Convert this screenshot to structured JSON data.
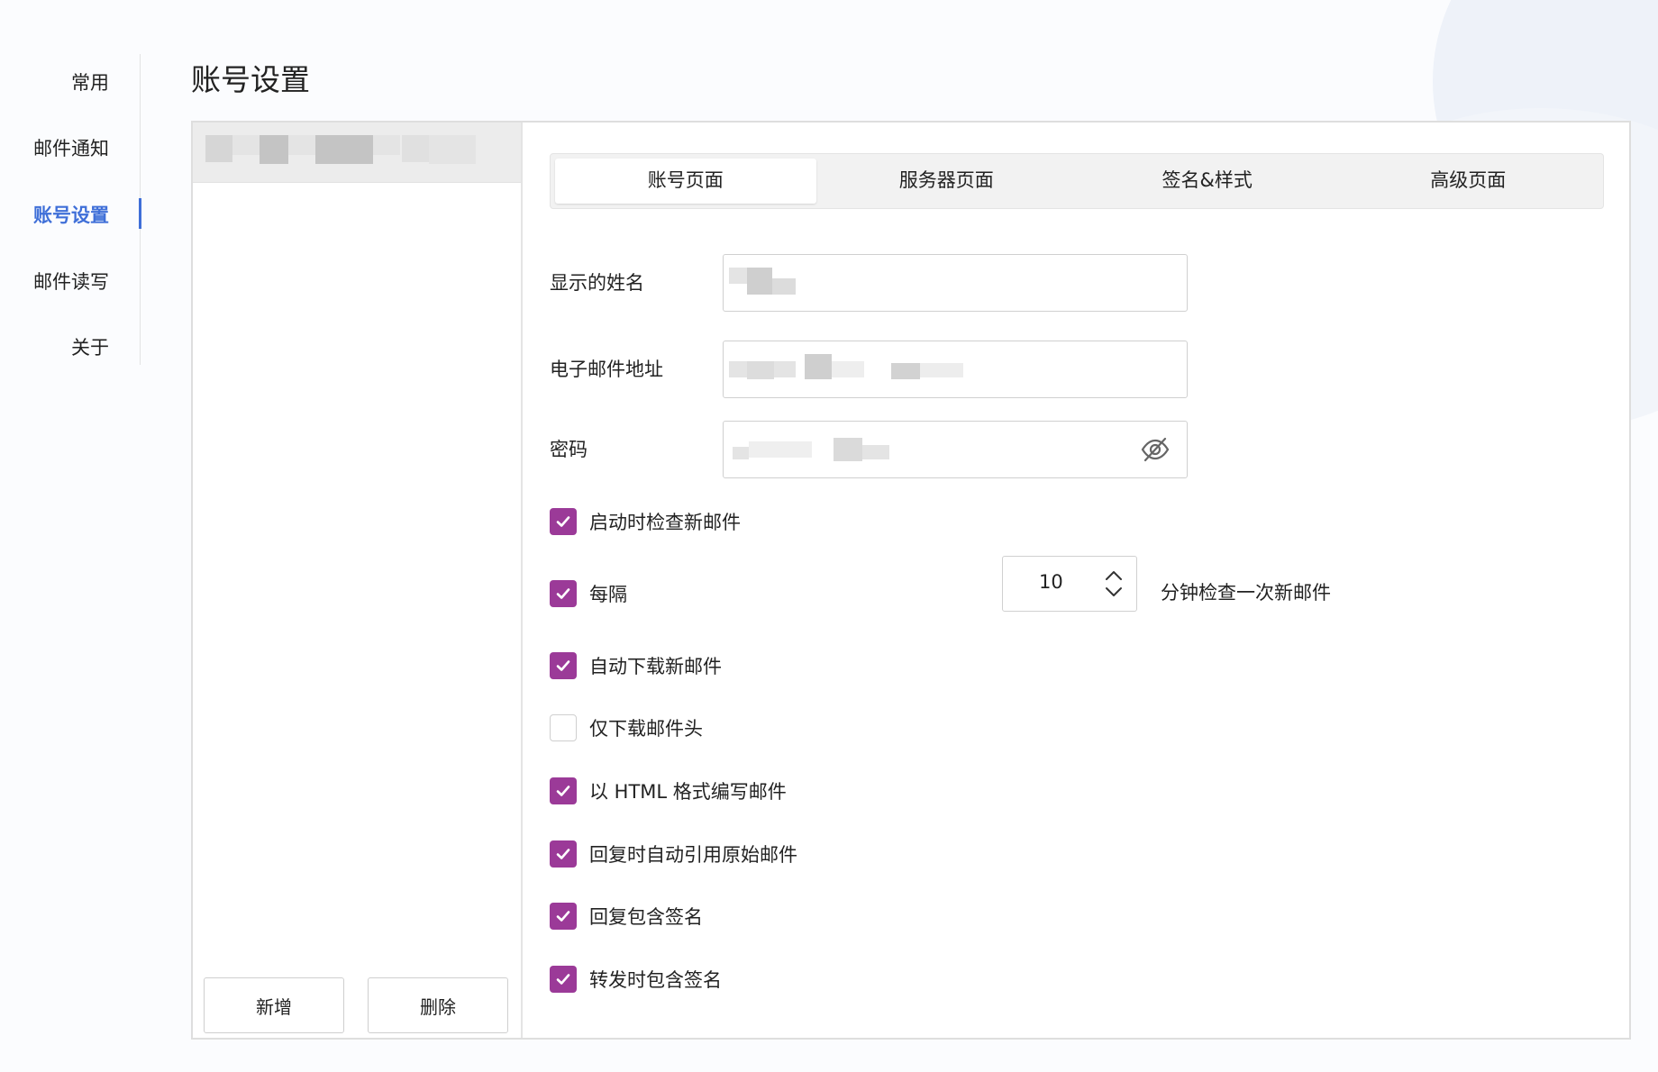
{
  "nav": {
    "items": [
      {
        "label": "常用"
      },
      {
        "label": "邮件通知"
      },
      {
        "label": "账号设置",
        "active": true
      },
      {
        "label": "邮件读写"
      },
      {
        "label": "关于"
      }
    ]
  },
  "page": {
    "title": "账号设置"
  },
  "accounts": {
    "add_label": "新增",
    "delete_label": "删除"
  },
  "tabs": [
    {
      "label": "账号页面",
      "active": true
    },
    {
      "label": "服务器页面"
    },
    {
      "label": "签名&样式"
    },
    {
      "label": "高级页面"
    }
  ],
  "form": {
    "display_name_label": "显示的姓名",
    "email_label": "电子邮件地址",
    "password_label": "密码",
    "check_on_start": {
      "label": "启动时检查新邮件",
      "checked": true
    },
    "interval": {
      "label": "每隔",
      "value": "10",
      "suffix": "分钟检查一次新邮件",
      "checked": true
    },
    "auto_download": {
      "label": "自动下载新邮件",
      "checked": true
    },
    "headers_only": {
      "label": "仅下载邮件头",
      "checked": false
    },
    "html_compose": {
      "label": "以 HTML 格式编写邮件",
      "checked": true
    },
    "quote_original": {
      "label": "回复时自动引用原始邮件",
      "checked": true
    },
    "reply_signature": {
      "label": "回复包含签名",
      "checked": true
    },
    "forward_signature": {
      "label": "转发时包含签名",
      "checked": true
    }
  },
  "colors": {
    "accent": "#3f6fd8",
    "checkbox": "#9b3a98"
  },
  "icons": {
    "password_toggle": "eye-off-icon",
    "check": "check-icon",
    "stepper": "chevron-up-down-icon"
  }
}
